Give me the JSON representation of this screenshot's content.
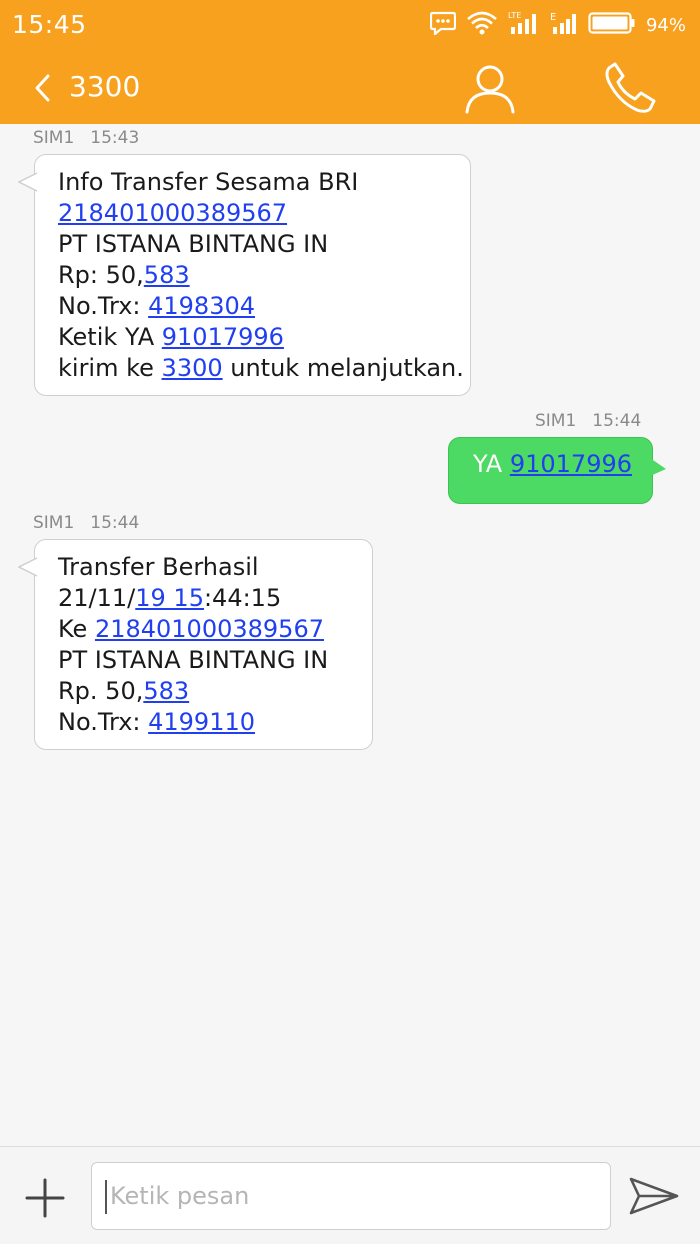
{
  "status_bar": {
    "time": "15:45",
    "battery_percent": "94%",
    "icons": [
      "message-notification-icon",
      "wifi-icon",
      "lte-signal-icon",
      "signal-icon",
      "battery-icon"
    ]
  },
  "header": {
    "title": "3300",
    "icons": [
      "back-chevron-icon",
      "contact-icon",
      "phone-icon"
    ]
  },
  "messages": [
    {
      "direction": "incoming",
      "sim": "SIM1",
      "time": "15:43",
      "lines": [
        [
          "Info Transfer Sesama BRI"
        ],
        [
          "",
          "218401000389567"
        ],
        [
          "PT ISTANA BINTANG IN"
        ],
        [
          "Rp: 50,",
          "583"
        ],
        [
          "No.Trx: ",
          "4198304"
        ],
        [
          "Ketik YA ",
          "91017996"
        ],
        [
          "kirim ke ",
          "3300",
          " untuk melanjutkan."
        ]
      ]
    },
    {
      "direction": "outgoing",
      "sim": "SIM1",
      "time": "15:44",
      "lines": [
        [
          "YA ",
          "91017996"
        ]
      ]
    },
    {
      "direction": "incoming",
      "sim": "SIM1",
      "time": "15:44",
      "lines": [
        [
          "Transfer Berhasil"
        ],
        [
          "21/11/",
          "19 15",
          ":44:15"
        ],
        [
          "Ke ",
          "218401000389567"
        ],
        [
          "PT ISTANA BINTANG IN"
        ],
        [
          "Rp. 50,",
          "583"
        ],
        [
          "No.Trx: ",
          "4199110"
        ]
      ]
    }
  ],
  "composer": {
    "placeholder": "Ketik pesan",
    "icons": [
      "add-icon",
      "send-icon"
    ]
  },
  "colors": {
    "accent": "#f7a11e",
    "outgoing_bubble": "#4cd964",
    "link": "#1f3ff0"
  }
}
